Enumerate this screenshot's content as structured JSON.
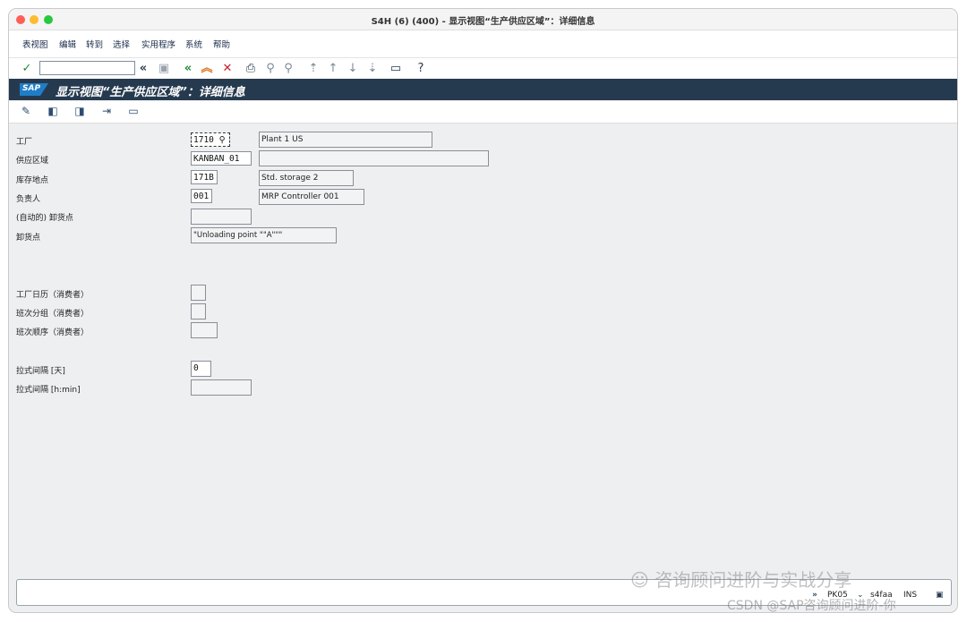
{
  "window": {
    "title": "S4H (6) (400) - 显示视图“生产供应区域”：详细信息"
  },
  "menu": [
    "表视图",
    "编辑",
    "转到",
    "选择",
    "实用程序",
    "系统",
    "帮助"
  ],
  "toolbar": {
    "icons": [
      "check-icon",
      "back-double-icon",
      "save-icon",
      "back-icon",
      "exit-icon",
      "cancel-icon",
      "print-icon",
      "find-icon",
      "find-next-icon",
      "first-page-icon",
      "prev-page-icon",
      "next-page-icon",
      "last-page-icon",
      "layout-icon",
      "help-icon"
    ]
  },
  "sapbar": {
    "logo": "SAP",
    "title": "显示视图“生产供应区域”：详细信息"
  },
  "app_toolbar": {
    "icons": [
      "display-change-icon",
      "previous-entry-icon",
      "next-entry-icon",
      "expand-icon",
      "variant-icon"
    ]
  },
  "form": {
    "plant": {
      "label": "工厂",
      "value": "1710",
      "desc": "Plant 1 US"
    },
    "supply_area": {
      "label": "供应区域",
      "value": "KANBAN_01",
      "desc": ""
    },
    "storage_location": {
      "label": "库存地点",
      "value": "171B",
      "desc": "Std. storage 2"
    },
    "responsible": {
      "label": "负责人",
      "value": "001",
      "desc": "MRP Controller 001"
    },
    "auto_unloading": {
      "label": "(自动的) 卸货点",
      "value": ""
    },
    "unloading_point": {
      "label": "卸货点",
      "value": "\"Unloading point \"\"A\"\"\""
    },
    "plant_calendar": {
      "label": "工厂日历（消费者）",
      "value": ""
    },
    "shift_group": {
      "label": "班次分组（消费者）",
      "value": ""
    },
    "shift_sequence": {
      "label": "班次顺序（消费者）",
      "value": ""
    },
    "pull_interval_days": {
      "label": "拉式间隔 [天]",
      "value": "0"
    },
    "pull_interval_hmin": {
      "label": "拉式间隔 [h:min]",
      "value": ""
    }
  },
  "status": {
    "transaction": "PK05",
    "server": "s4faa",
    "mode": "INS"
  },
  "watermark": {
    "line1": "咨询顾问进阶与实战分享",
    "line2": "CSDN @SAP咨询顾问进阶-你"
  }
}
